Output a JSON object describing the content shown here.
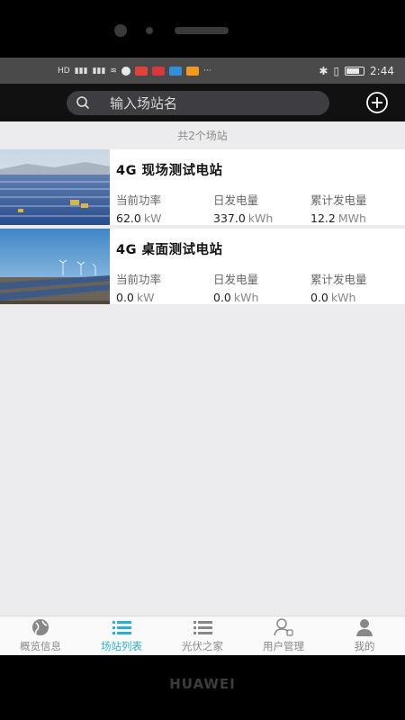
{
  "device": {
    "brand": "HUAWEI"
  },
  "statusbar": {
    "left_items": [
      "HD",
      "4G",
      "4G",
      "wifi"
    ],
    "time": "2:44",
    "more": "···"
  },
  "search": {
    "placeholder": "输入场站名"
  },
  "list": {
    "count_text": "共2个场站",
    "stations": [
      {
        "name": "4G 现场测试电站",
        "metrics": [
          {
            "label": "当前功率",
            "value": "62.0",
            "unit": "kW"
          },
          {
            "label": "日发电量",
            "value": "337.0",
            "unit": "kWh"
          },
          {
            "label": "累计发电量",
            "value": "12.2",
            "unit": "MWh"
          }
        ]
      },
      {
        "name": "4G 桌面测试电站",
        "metrics": [
          {
            "label": "当前功率",
            "value": "0.0",
            "unit": "kW"
          },
          {
            "label": "日发电量",
            "value": "0.0",
            "unit": "kWh"
          },
          {
            "label": "累计发电量",
            "value": "0.0",
            "unit": "kWh"
          }
        ]
      }
    ]
  },
  "tabs": [
    {
      "label": "概览信息",
      "icon": "globe-icon",
      "active": false
    },
    {
      "label": "场站列表",
      "icon": "list-icon",
      "active": true
    },
    {
      "label": "光伏之家",
      "icon": "list-icon",
      "active": false
    },
    {
      "label": "用户管理",
      "icon": "users-icon",
      "active": false
    },
    {
      "label": "我的",
      "icon": "person-icon",
      "active": false
    }
  ],
  "colors": {
    "accent": "#2ab0d8",
    "header_bg": "#111111",
    "search_bg": "#3e3e42"
  }
}
